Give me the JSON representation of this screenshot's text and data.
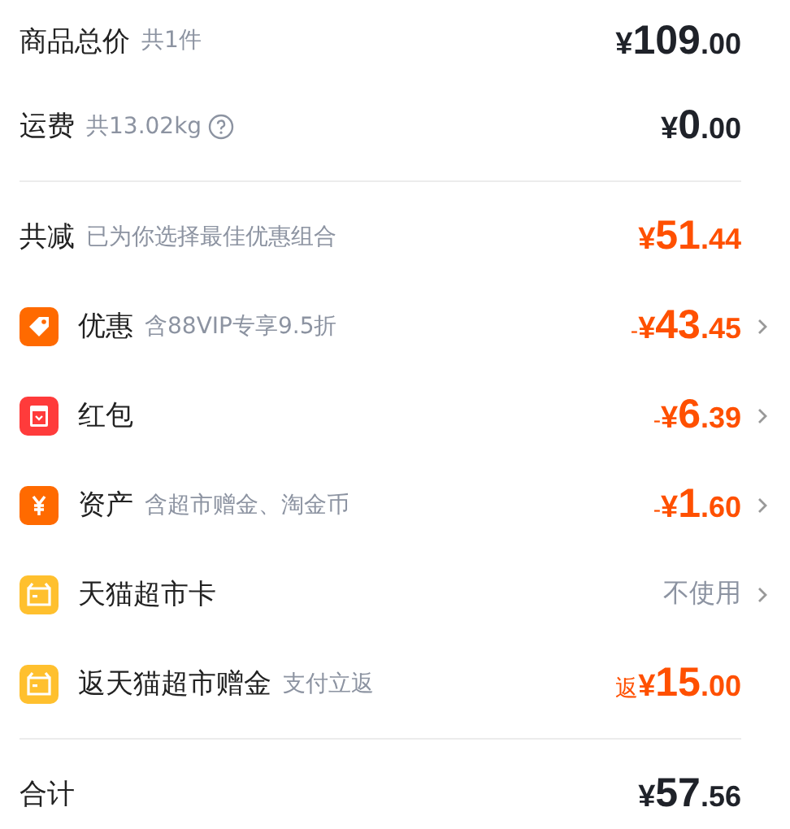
{
  "sections": [
    {
      "rows": [
        {
          "label": "商品总价",
          "note": "共1件",
          "amount": {
            "yen": "¥",
            "integer": "109",
            "decimal": ".00"
          },
          "color": "#1f2229"
        },
        {
          "label": "运费",
          "note": "共13.02kg",
          "amount": {
            "yen": "¥",
            "integer": "0",
            "decimal": ".00"
          },
          "color": "#1f2229",
          "help": true
        }
      ]
    },
    {
      "rows": [
        {
          "label": "共减",
          "note": "已为你选择最佳优惠组合",
          "amount": {
            "yen": "¥",
            "integer": "51",
            "decimal": ".44"
          },
          "color": "#ff5000"
        },
        {
          "kind": "tag",
          "label": "优惠",
          "note": "含88VIP专享9.5折",
          "amount": {
            "prefix": "-",
            "yen": "¥",
            "integer": "43",
            "decimal": ".45"
          },
          "color": "#ff5000",
          "chevron": true
        },
        {
          "kind": "packet",
          "label": "红包",
          "amount": {
            "prefix": "-",
            "yen": "¥",
            "integer": "6",
            "decimal": ".39"
          },
          "color": "#ff5000",
          "chevron": true
        },
        {
          "kind": "yen",
          "label": "资产",
          "note": "含超市赠金、淘金币",
          "amount": {
            "prefix": "-",
            "yen": "¥",
            "integer": "1",
            "decimal": ".60"
          },
          "color": "#ff5000",
          "chevron": true
        },
        {
          "kind": "card",
          "label": "天猫超市卡",
          "value": "不使用",
          "chevron": true
        },
        {
          "kind": "card",
          "label": "返天猫超市赠金",
          "note": "支付立返",
          "amount": {
            "prefix": "返",
            "yen": "¥",
            "integer": "15",
            "decimal": ".00"
          },
          "color": "#ff5000"
        }
      ]
    },
    {
      "rows": [
        {
          "label": "合计",
          "amount": {
            "yen": "¥",
            "integer": "57",
            "decimal": ".56"
          },
          "color": "#1f2229"
        }
      ]
    }
  ]
}
